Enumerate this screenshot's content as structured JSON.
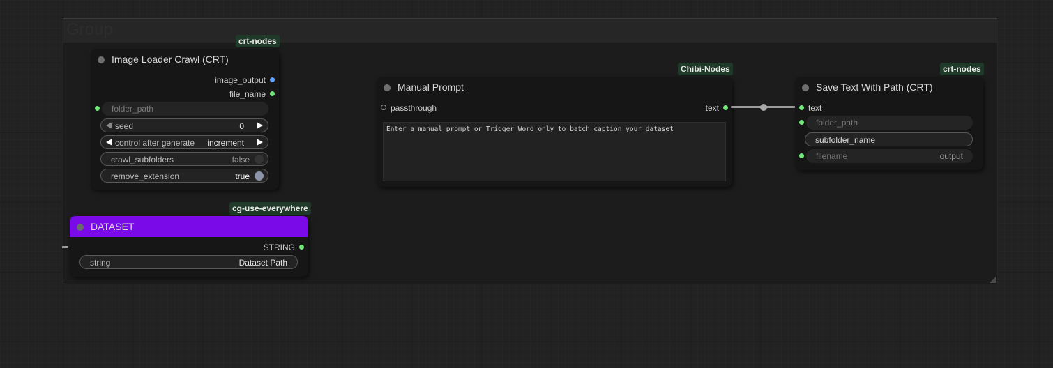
{
  "group": {
    "title": "Group"
  },
  "nodes": {
    "image_loader": {
      "badge": "crt-nodes",
      "title": "Image Loader Crawl (CRT)",
      "outputs": [
        "image_output",
        "file_name"
      ],
      "input": "folder_path",
      "widgets": {
        "seed": {
          "label": "seed",
          "value": "0"
        },
        "control": {
          "label": "control after generate",
          "value": "increment"
        },
        "crawl_subfolders": {
          "label": "crawl_subfolders",
          "value": "false"
        },
        "remove_extension": {
          "label": "remove_extension",
          "value": "true"
        }
      }
    },
    "dataset": {
      "badge": "cg-use-everywhere",
      "title": "DATASET",
      "title_color": "#7a0ae8",
      "output": "STRING",
      "widget": {
        "label": "string",
        "value": "Dataset Path"
      }
    },
    "manual_prompt": {
      "badge": "Chibi-Nodes",
      "title": "Manual Prompt",
      "input": "passthrough",
      "output": "text",
      "text": "Enter a manual prompt or Trigger Word only to batch caption your dataset"
    },
    "save_text": {
      "badge": "crt-nodes",
      "title": "Save Text With Path (CRT)",
      "input": "text",
      "folder_path": "folder_path",
      "subfolder_name": "subfolder_name",
      "filename": {
        "label": "filename",
        "value": "output"
      }
    }
  },
  "colors": {
    "canvas": "#222222",
    "node_body": "#161616",
    "slot_green": "#72e87a",
    "slot_blue": "#5ea2ff",
    "badge_bg": "#1f3a28"
  }
}
